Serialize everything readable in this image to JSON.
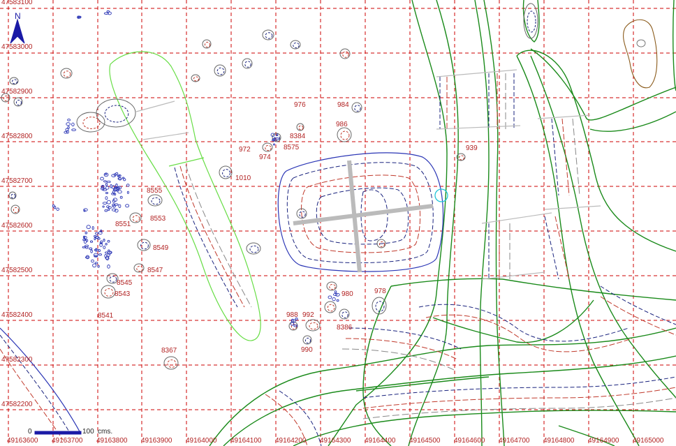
{
  "map": {
    "easting_labels": [
      "49163600",
      "49163700",
      "49163800",
      "49163900",
      "49164000",
      "49164100",
      "49164200",
      "49164300",
      "49164400",
      "49164500",
      "49164600",
      "49164700",
      "49164800",
      "49164900",
      "49165000"
    ],
    "northing_labels": [
      "47583100",
      "47583000",
      "47582900",
      "47582800",
      "47582700",
      "47582600",
      "47582500",
      "47582400",
      "47582300",
      "47582200"
    ],
    "site_labels": [
      "976",
      "984",
      "986",
      "8384",
      "8575",
      "972",
      "974",
      "939",
      "1010",
      "8555",
      "8551",
      "8553",
      "8549",
      "8547",
      "8545",
      "8543",
      "8541",
      "980",
      "978",
      "988",
      "992",
      "8386",
      "990",
      "8367"
    ],
    "scale_bar": {
      "start": "0",
      "end": "100",
      "unit": "cms."
    },
    "north_arrow": {
      "label": "N"
    },
    "colors": {
      "grid": "#cc0000",
      "green_contour": "#1a8a1a",
      "light_green": "#66dd44",
      "blue_contour": "#2a35b5",
      "red_contour": "#c0392b",
      "navy_dash": "#1a237e",
      "brown": "#8a5a1a",
      "cyan": "#22c4d8",
      "gray": "#888888"
    }
  }
}
